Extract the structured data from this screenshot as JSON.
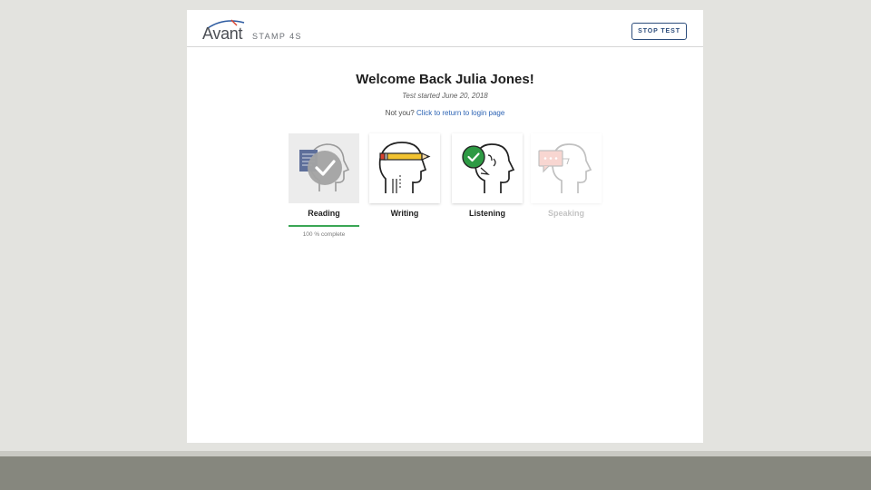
{
  "header": {
    "logo_word": "Avant",
    "logo_sub": "STAMP 4S",
    "stop_label": "STOP TEST"
  },
  "welcome": {
    "title": "Welcome Back Julia Jones!",
    "started": "Test started June 20, 2018",
    "not_you": "Not you?",
    "login_link": "Click to return to login page"
  },
  "sections": [
    {
      "label": "Reading",
      "status": "complete",
      "icon": "reading-icon",
      "progress_text": "100 % complete",
      "progress": 1.0
    },
    {
      "label": "Writing",
      "status": "available",
      "icon": "writing-icon"
    },
    {
      "label": "Listening",
      "status": "available-checked",
      "icon": "listening-icon"
    },
    {
      "label": "Speaking",
      "status": "disabled",
      "icon": "speaking-icon"
    }
  ],
  "colors": {
    "accent": "#2d4d7c",
    "link": "#2c63b4",
    "complete_green": "#3aa655",
    "check_green": "#2e9a44",
    "pencil_yellow": "#f2c230",
    "pencil_red": "#d9432f"
  }
}
